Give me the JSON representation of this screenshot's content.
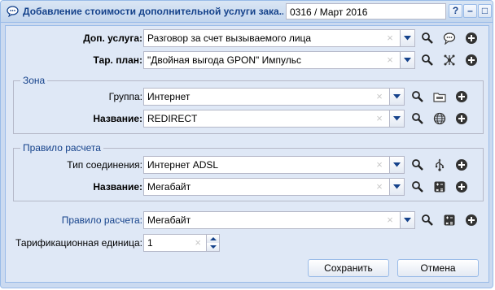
{
  "window": {
    "title": "Добавление стоимости дополнительной услуги зака...",
    "period": "0316 / Март 2016",
    "help_label": "?",
    "minimize_label": "–",
    "maximize_label": "□",
    "close_label": "×"
  },
  "service": {
    "label": "Доп. услуга:",
    "value": "Разговор за счет вызываемого лица"
  },
  "tariff": {
    "label": "Тар. план:",
    "value": "\"Двойная выгода GPON\" Импульс"
  },
  "zone": {
    "legend": "Зона",
    "group_label": "Группа:",
    "group_value": "Интернет",
    "name_label": "Название:",
    "name_value": "REDIRECT"
  },
  "rule": {
    "legend": "Правило расчета",
    "conn_label": "Тип соединения:",
    "conn_value": "Интернет ADSL",
    "name_label": "Название:",
    "name_value": "Мегабайт"
  },
  "calc_rule": {
    "label": "Правило расчета:",
    "value": "Мегабайт"
  },
  "unit": {
    "label": "Тарификационная единица:",
    "value": "1"
  },
  "buttons": {
    "save": "Сохранить",
    "cancel": "Отмена"
  },
  "clear_glyph": "×",
  "colors": {
    "title_text": "#15428b",
    "window_border": "#99bbe8",
    "panel_bg": "#dfe8f6",
    "field_border": "#b5b8c8"
  }
}
